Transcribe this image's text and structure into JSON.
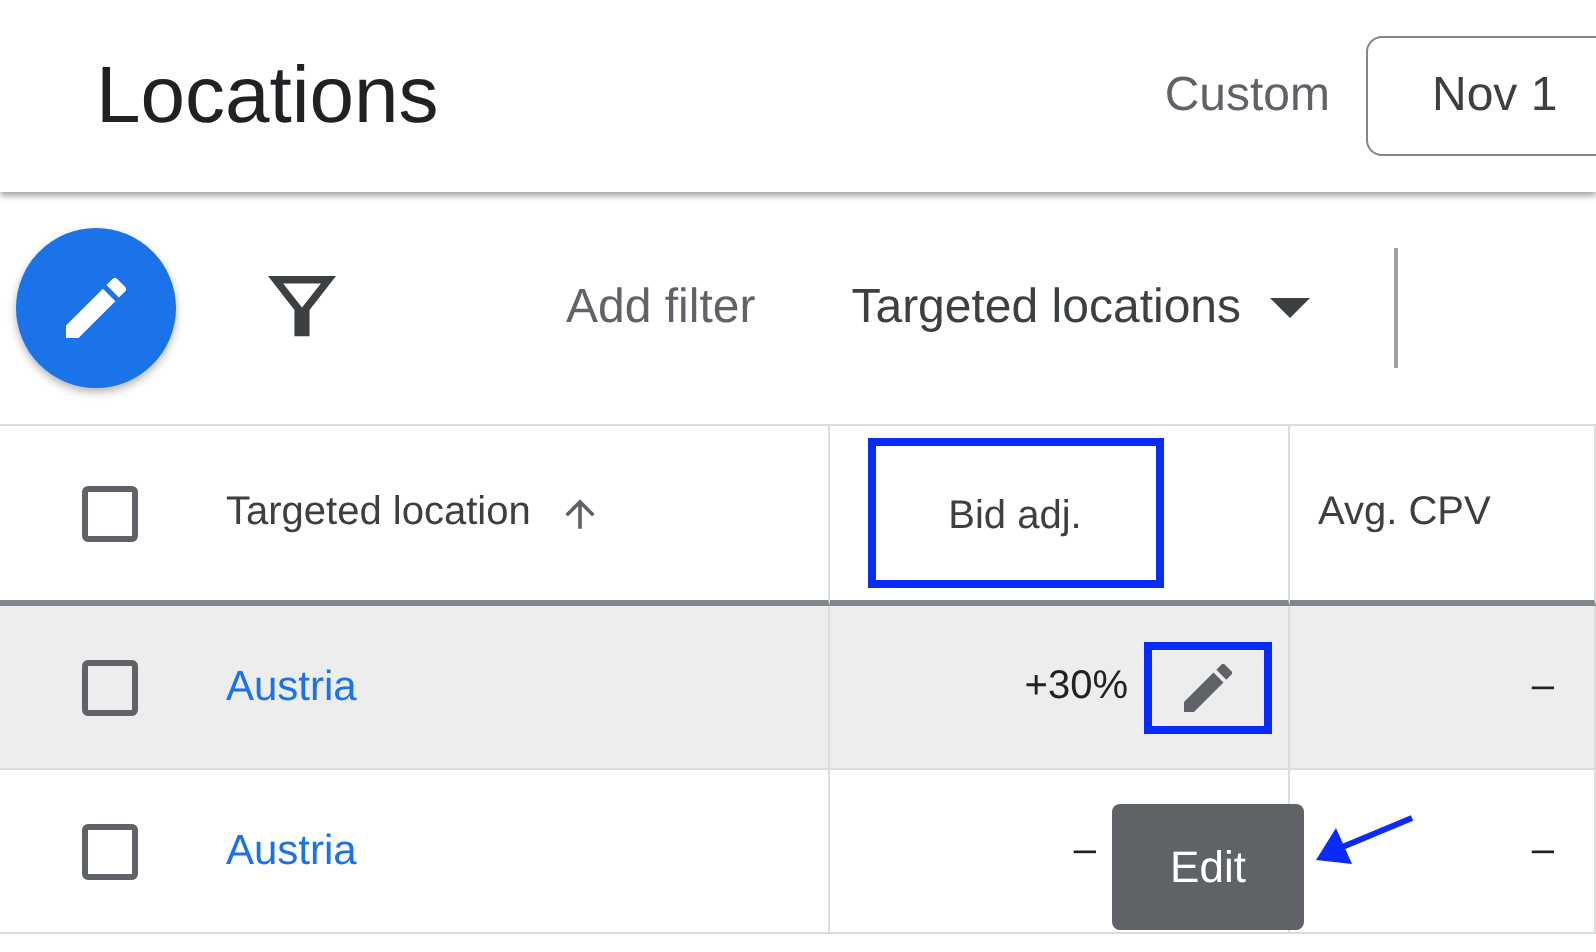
{
  "header": {
    "title": "Locations",
    "date_label": "Custom",
    "date_range": "Nov 1"
  },
  "toolbar": {
    "add_filter": "Add filter",
    "view_dropdown": "Targeted locations"
  },
  "table": {
    "select_all_checked": false,
    "columns": [
      {
        "label": "Targeted location",
        "sorted": true,
        "annotated": false
      },
      {
        "label": "Bid adj.",
        "sorted": false,
        "annotated": true
      },
      {
        "label": "Avg. CPV",
        "sorted": false,
        "annotated": false
      }
    ],
    "rows": [
      {
        "checked": false,
        "hovered": true,
        "location": "Austria",
        "bid_adj": "+30%",
        "edit_button": true,
        "annotated": true,
        "avg_cpv": "–"
      },
      {
        "checked": false,
        "hovered": false,
        "location": "Austria",
        "bid_adj": "–",
        "edit_button": false,
        "annotated": false,
        "avg_cpv": "–"
      }
    ]
  },
  "tooltip": {
    "text": "Edit"
  }
}
